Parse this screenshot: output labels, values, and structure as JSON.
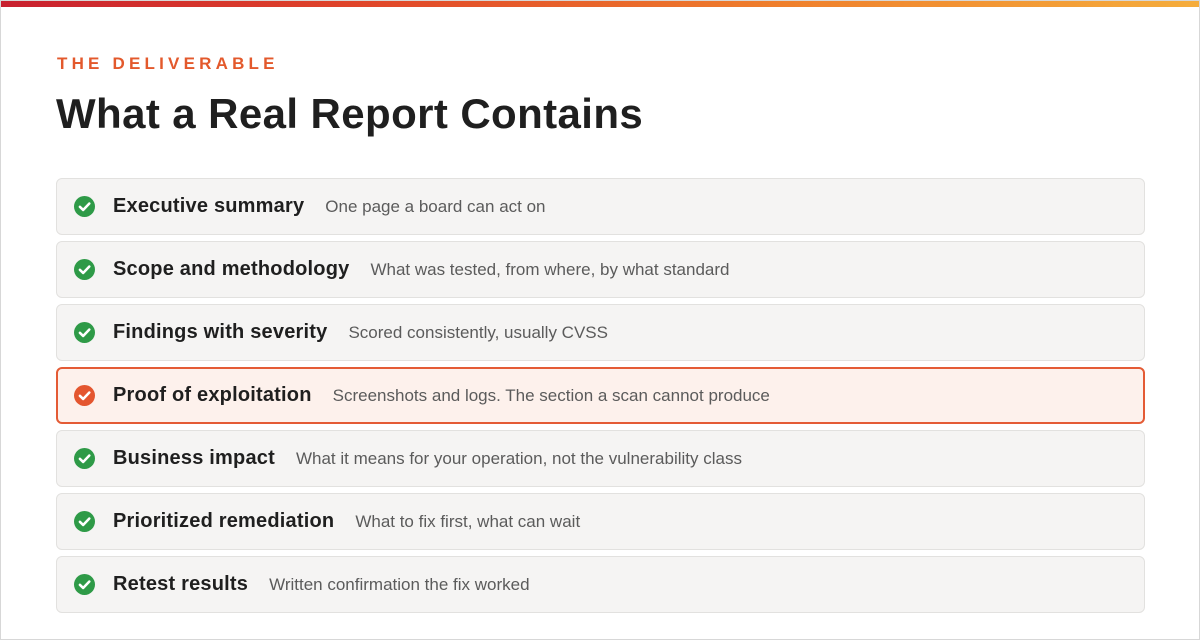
{
  "eyebrow": "THE DELIVERABLE",
  "title": "What a Real Report Contains",
  "colors": {
    "accent": "#e3592c",
    "check_default": "#2e9a47",
    "check_highlight": "#e4562f"
  },
  "items": [
    {
      "label": "Executive summary",
      "description": "One page a board can act on",
      "icon": "check-circle-icon",
      "highlighted": false
    },
    {
      "label": "Scope and methodology",
      "description": "What was tested, from where, by what standard",
      "icon": "check-circle-icon",
      "highlighted": false
    },
    {
      "label": "Findings with severity",
      "description": "Scored consistently, usually CVSS",
      "icon": "check-circle-icon",
      "highlighted": false
    },
    {
      "label": "Proof of exploitation",
      "description": "Screenshots and logs. The section a scan cannot produce",
      "icon": "check-circle-icon",
      "highlighted": true
    },
    {
      "label": "Business impact",
      "description": "What it means for your operation, not the vulnerability class",
      "icon": "check-circle-icon",
      "highlighted": false
    },
    {
      "label": "Prioritized remediation",
      "description": "What to fix first, what can wait",
      "icon": "check-circle-icon",
      "highlighted": false
    },
    {
      "label": "Retest results",
      "description": "Written confirmation the fix worked",
      "icon": "check-circle-icon",
      "highlighted": false
    }
  ]
}
